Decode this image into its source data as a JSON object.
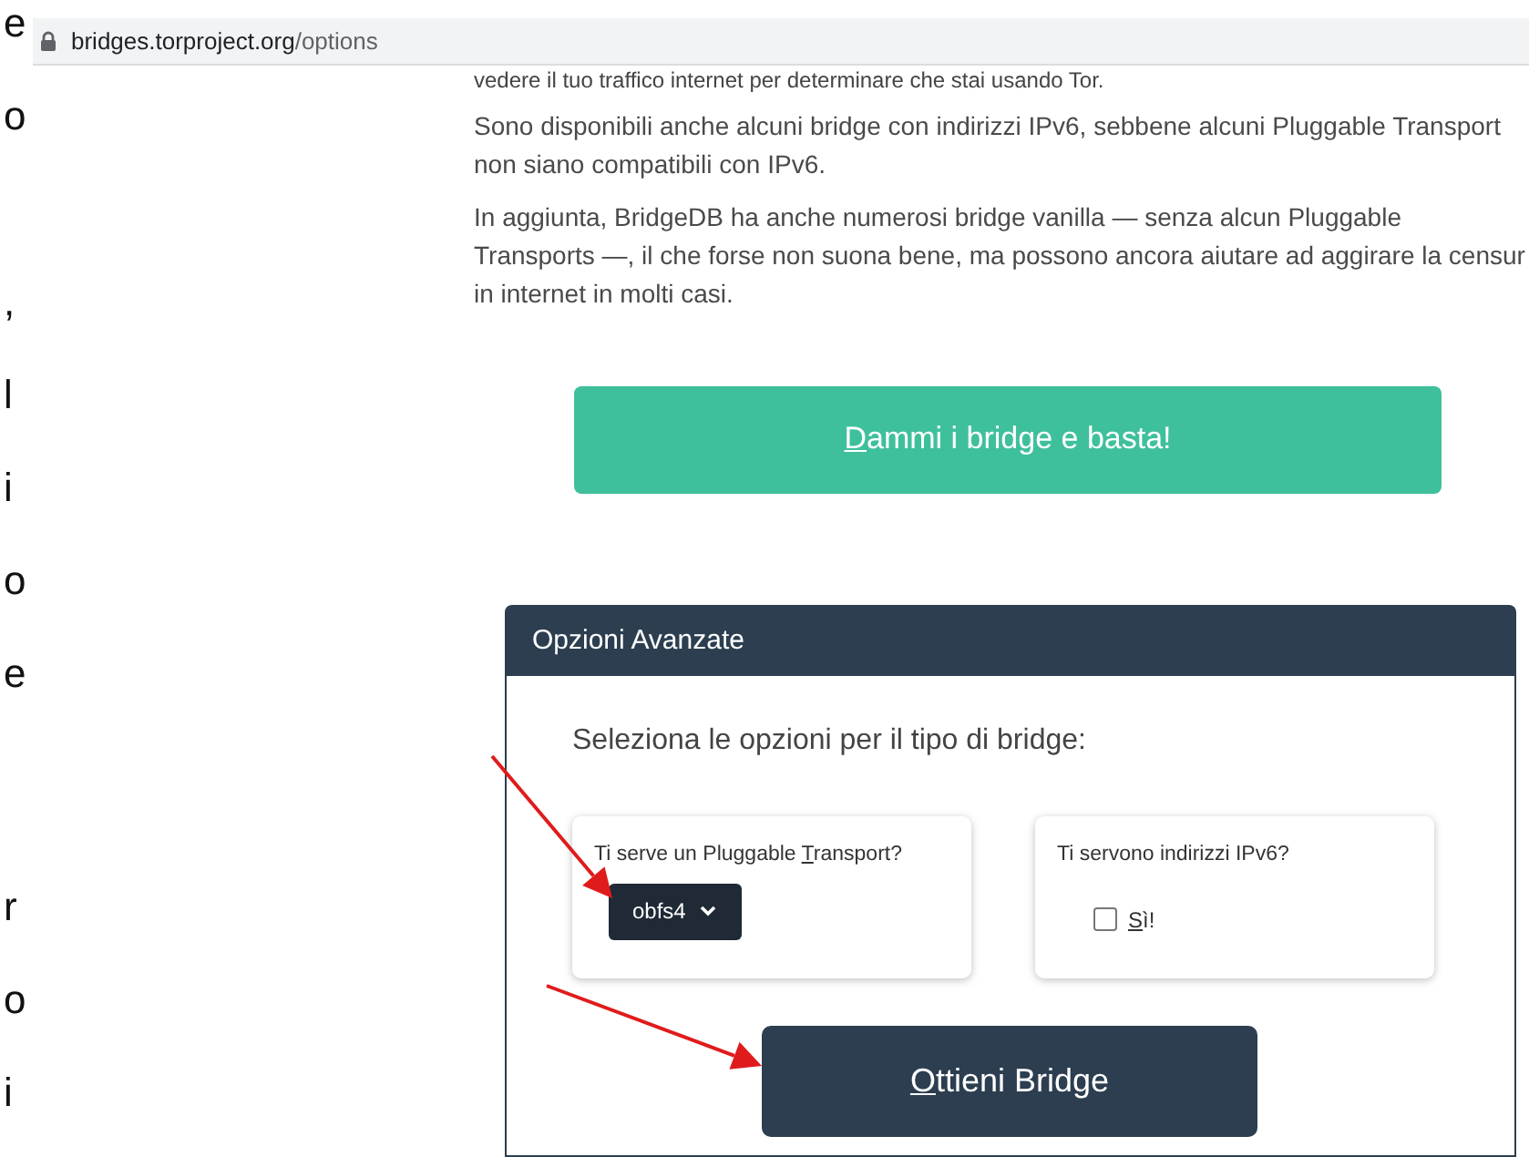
{
  "left_fragments": [
    [
      "e",
      "o"
    ],
    [
      ",",
      "l",
      "i",
      "o",
      "e"
    ],
    [
      "r",
      "o",
      "i"
    ]
  ],
  "address_bar": {
    "host": "bridges.torproject.org",
    "path": "/options"
  },
  "cut_line": "vedere il tuo traffico internet per determinare che stai usando Tor.",
  "paragraphs": [
    [
      "Sono disponibili anche alcuni bridge con indirizzi IPv6, sebbene alcuni Pluggable Transport",
      "non siano compatibili con IPv6."
    ],
    [
      "In aggiunta, BridgeDB ha anche numerosi bridge vanilla — senza alcun Pluggable",
      "Transports —, il che forse non suona bene, ma possono ancora aiutare ad aggirare la censur",
      "in internet in molti casi."
    ]
  ],
  "just_give_button": {
    "label": "Dammi i bridge e basta!",
    "underline_first": true
  },
  "advanced": {
    "title": "Opzioni Avanzate",
    "intro": "Seleziona le opzioni per il tipo di bridge:",
    "transport": {
      "label_before": "Ti serve un Pluggable ",
      "label_key": "T",
      "label_after": "ransport?",
      "value": "obfs4"
    },
    "ipv6": {
      "label": "Ti servono indirizzi IPv6?",
      "option": "Sì!",
      "checked": false
    },
    "submit": {
      "label": "Ottieni Bridge",
      "underline_first": true
    }
  },
  "annotations": [
    {
      "kind": "arrow"
    },
    {
      "kind": "arrow"
    }
  ]
}
